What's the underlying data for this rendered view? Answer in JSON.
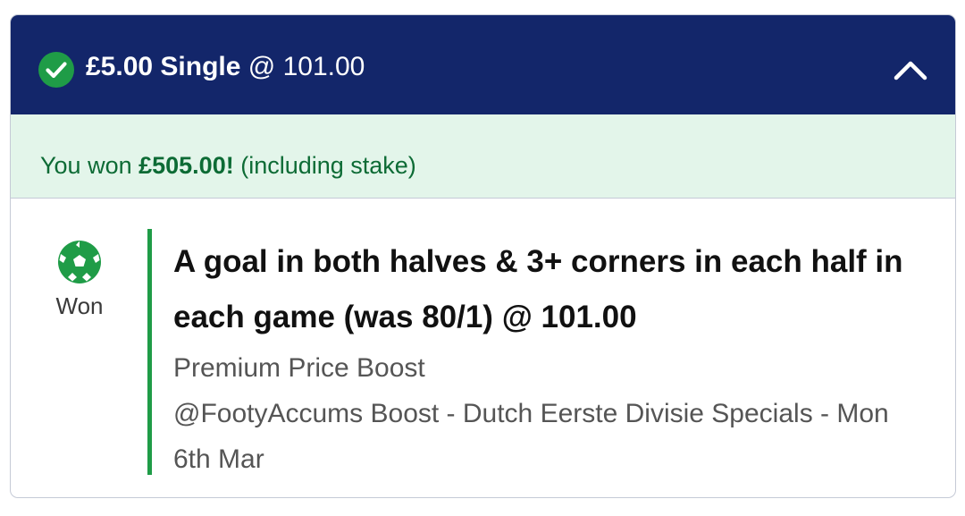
{
  "header": {
    "stake": "£5.00",
    "bet_type": "Single",
    "odds_text": "@ 101.00",
    "colors": {
      "background": "#13266a",
      "check": "#1f9c47"
    },
    "icons": {
      "status": "check-circle-icon",
      "toggle": "chevron-up-icon"
    }
  },
  "result_bar": {
    "prefix": "You won ",
    "amount": "£505.00!",
    "suffix": " (including stake)",
    "colors": {
      "background": "#e3f5ea",
      "text": "#0d6b35"
    }
  },
  "selection": {
    "status_icon": "football-icon",
    "status_label": "Won",
    "title": "A goal in both halves & 3+ corners in each half in each game (was 80/1) @ 101.00",
    "market": "Premium Price Boost",
    "event": "@FootyAccums Boost - Dutch Eerste Divisie Specials - Mon 6th Mar",
    "colors": {
      "accent": "#1f9c47"
    }
  }
}
